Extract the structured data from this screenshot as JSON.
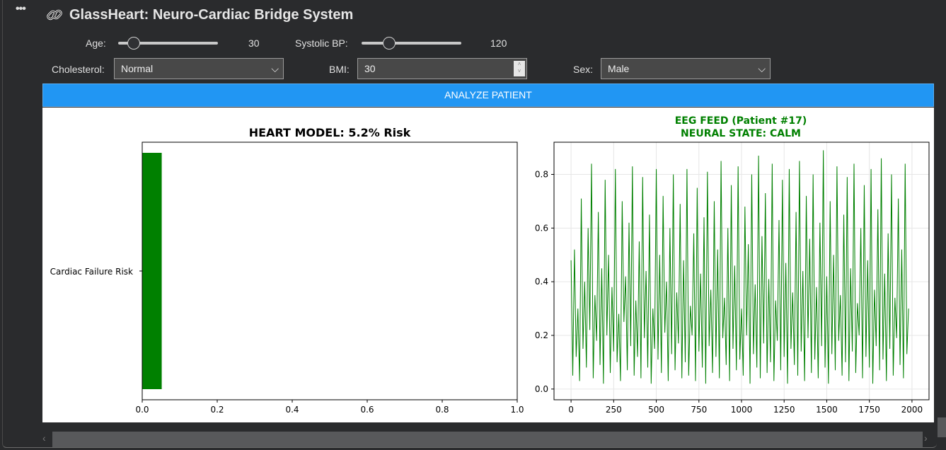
{
  "app": {
    "title": "GlassHeart: Neuro-Cardiac Bridge System",
    "menu_icon": "ellipsis-icon",
    "title_icon": "link-icon"
  },
  "controls": {
    "age": {
      "label": "Age:",
      "value": "30",
      "fraction": 0.1
    },
    "systolic": {
      "label": "Systolic BP:",
      "value": "120",
      "fraction": 0.28
    },
    "cholesterol": {
      "label": "Cholesterol:",
      "value": "Normal"
    },
    "bmi": {
      "label": "BMI:",
      "value": "30"
    },
    "sex": {
      "label": "Sex:",
      "value": "Male"
    },
    "analyze_label": "ANALYZE PATIENT"
  },
  "chart_data": [
    {
      "type": "bar",
      "orientation": "horizontal",
      "title": "HEART MODEL: 5.2% Risk",
      "categories": [
        "Cardiac Failure Risk"
      ],
      "values": [
        0.052
      ],
      "xlim": [
        0,
        1
      ],
      "xticks": [
        "0.0",
        "0.2",
        "0.4",
        "0.6",
        "0.8",
        "1.0"
      ],
      "color": "#008000",
      "grid": false
    },
    {
      "type": "line",
      "title": "EEG FEED (Patient #17)",
      "subtitle": "NEURAL STATE: CALM",
      "title_color": "#008000",
      "color": "#008000",
      "grid": true,
      "xlim": [
        -100,
        2100
      ],
      "ylim": [
        -0.04,
        0.92
      ],
      "xticks": [
        "0",
        "250",
        "500",
        "750",
        "1000",
        "1250",
        "1500",
        "1750",
        "2000"
      ],
      "yticks": [
        "0.0",
        "0.2",
        "0.4",
        "0.6",
        "0.8"
      ],
      "x_step": 10,
      "values": [
        0.48,
        0.05,
        0.52,
        0.12,
        0.3,
        0.03,
        0.71,
        0.15,
        0.4,
        0.08,
        0.6,
        0.22,
        0.84,
        0.04,
        0.35,
        0.18,
        0.66,
        0.09,
        0.45,
        0.02,
        0.78,
        0.2,
        0.5,
        0.06,
        0.38,
        0.14,
        0.82,
        0.1,
        0.28,
        0.03,
        0.7,
        0.25,
        0.42,
        0.07,
        0.62,
        0.16,
        0.83,
        0.05,
        0.33,
        0.12,
        0.55,
        0.04,
        0.79,
        0.19,
        0.44,
        0.08,
        0.65,
        0.02,
        0.3,
        0.15,
        0.82,
        0.11,
        0.5,
        0.06,
        0.72,
        0.21,
        0.4,
        0.03,
        0.6,
        0.13,
        0.8,
        0.07,
        0.36,
        0.17,
        0.69,
        0.04,
        0.48,
        0.1,
        0.82,
        0.05,
        0.31,
        0.2,
        0.58,
        0.03,
        0.75,
        0.14,
        0.43,
        0.08,
        0.64,
        0.02,
        0.81,
        0.16,
        0.37,
        0.06,
        0.7,
        0.12,
        0.52,
        0.04,
        0.85,
        0.19,
        0.34,
        0.09,
        0.6,
        0.03,
        0.76,
        0.15,
        0.46,
        0.07,
        0.83,
        0.11,
        0.3,
        0.05,
        0.68,
        0.2,
        0.54,
        0.02,
        0.8,
        0.13,
        0.39,
        0.08,
        0.87,
        0.04,
        0.57,
        0.17,
        0.73,
        0.06,
        0.41,
        0.1,
        0.84,
        0.03,
        0.33,
        0.18,
        0.63,
        0.07,
        0.78,
        0.12,
        0.47,
        0.02,
        0.82,
        0.15,
        0.36,
        0.09,
        0.66,
        0.05,
        0.85,
        0.14,
        0.44,
        0.03,
        0.72,
        0.19,
        0.56,
        0.06,
        0.8,
        0.11,
        0.38,
        0.04,
        0.62,
        0.16,
        0.89,
        0.08,
        0.42,
        0.02,
        0.7,
        0.13,
        0.5,
        0.07,
        0.83,
        0.18,
        0.35,
        0.05,
        0.65,
        0.1,
        0.79,
        0.03,
        0.45,
        0.14,
        0.84,
        0.06,
        0.32,
        0.2,
        0.6,
        0.04,
        0.76,
        0.12,
        0.48,
        0.08,
        0.82,
        0.02,
        0.37,
        0.16,
        0.67,
        0.07,
        0.86,
        0.11,
        0.43,
        0.03,
        0.58,
        0.15,
        0.8,
        0.05,
        0.34,
        0.19,
        0.71,
        0.09,
        0.52,
        0.04,
        0.84,
        0.13,
        0.3
      ]
    }
  ]
}
